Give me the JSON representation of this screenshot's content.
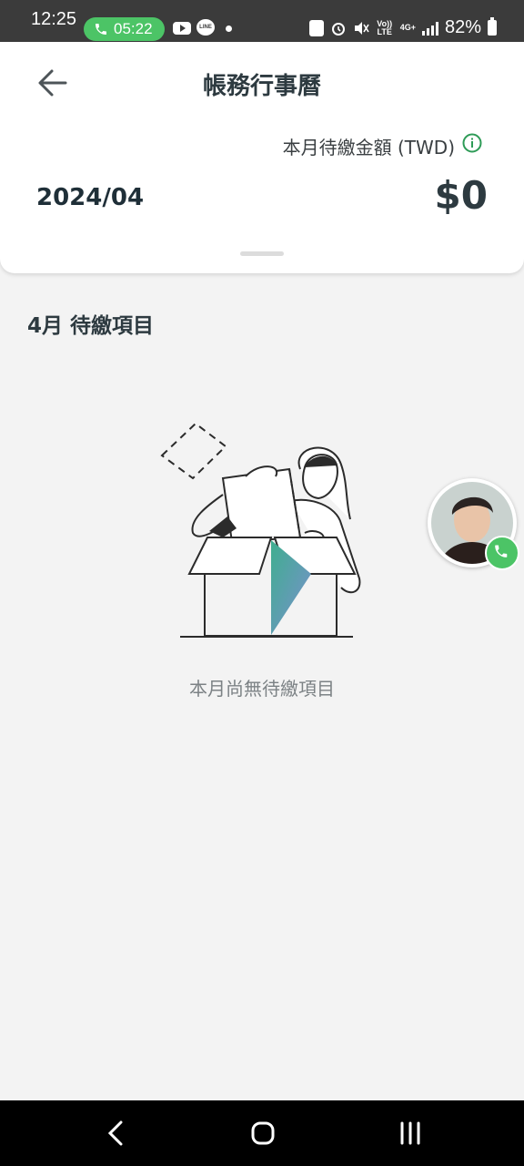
{
  "status_bar": {
    "time": "12:25",
    "call_duration": "05:22",
    "line_badge": "LINE",
    "volte_label": "Vo)) LTE",
    "network": "4G+",
    "battery": "82%"
  },
  "header": {
    "title": "帳務行事曆",
    "due_label": "本月待繳金額 (TWD)",
    "month": "2024/04",
    "amount": "$0"
  },
  "section": {
    "title": "4月 待繳項目",
    "empty_message": "本月尚無待繳項目"
  },
  "icons": {
    "back": "arrow-left-icon",
    "info": "info-icon",
    "call": "phone-icon"
  },
  "colors": {
    "accent_green": "#4cc466",
    "title_text": "#2d3a40",
    "info_green": "#2e9b57"
  }
}
